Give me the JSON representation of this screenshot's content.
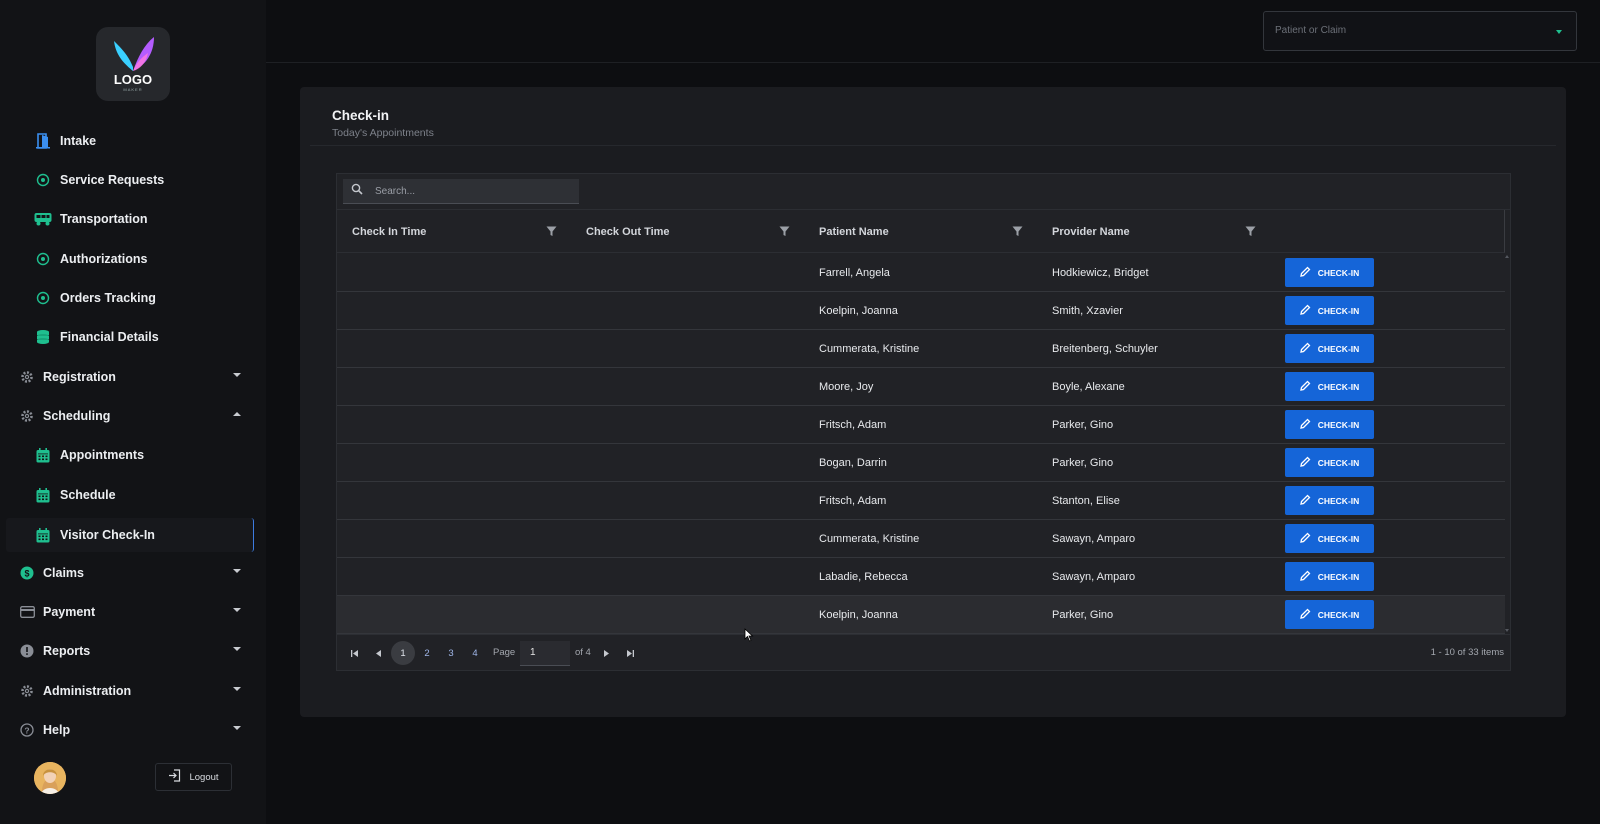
{
  "sidebar": {
    "logo_text": "LOGO",
    "logo_sub": "MAKER",
    "items": [
      {
        "label": "Intake",
        "icon": "door-icon",
        "type": "sub"
      },
      {
        "label": "Service Requests",
        "icon": "circle-dot-icon",
        "type": "sub"
      },
      {
        "label": "Transportation",
        "icon": "bus-icon",
        "type": "sub"
      },
      {
        "label": "Authorizations",
        "icon": "circle-dot-icon",
        "type": "sub"
      },
      {
        "label": "Orders Tracking",
        "icon": "circle-dot-icon",
        "type": "sub"
      },
      {
        "label": "Financial Details",
        "icon": "coins-icon",
        "type": "sub"
      },
      {
        "label": "Registration",
        "icon": "gear-icon",
        "type": "group",
        "expanded": false
      },
      {
        "label": "Scheduling",
        "icon": "gear-icon",
        "type": "group",
        "expanded": true
      },
      {
        "label": "Appointments",
        "icon": "calendar-icon",
        "type": "sub"
      },
      {
        "label": "Schedule",
        "icon": "calendar-icon",
        "type": "sub"
      },
      {
        "label": "Visitor Check-In",
        "icon": "calendar-icon",
        "type": "sub",
        "active": true
      },
      {
        "label": "Claims",
        "icon": "dollar-circle-icon",
        "type": "group",
        "expanded": false
      },
      {
        "label": "Payment",
        "icon": "credit-card-icon",
        "type": "group",
        "expanded": false
      },
      {
        "label": "Reports",
        "icon": "alert-circle-icon",
        "type": "group",
        "expanded": false
      },
      {
        "label": "Administration",
        "icon": "gear-icon",
        "type": "group",
        "expanded": false
      },
      {
        "label": "Help",
        "icon": "help-circle-icon",
        "type": "group",
        "expanded": false
      }
    ],
    "logout_label": "Logout"
  },
  "header": {
    "select_placeholder": "Patient or Claim"
  },
  "card": {
    "title": "Check-in",
    "subtitle": "Today's Appointments"
  },
  "grid": {
    "search_placeholder": "Search...",
    "columns": [
      "Check In Time",
      "Check Out Time",
      "Patient Name",
      "Provider Name"
    ],
    "action_label": "CHECK-IN",
    "rows": [
      {
        "check_in": "",
        "check_out": "",
        "patient": "Farrell, Angela",
        "provider": "Hodkiewicz, Bridget"
      },
      {
        "check_in": "",
        "check_out": "",
        "patient": "Koelpin, Joanna",
        "provider": "Smith, Xzavier"
      },
      {
        "check_in": "",
        "check_out": "",
        "patient": "Cummerata, Kristine",
        "provider": "Breitenberg, Schuyler"
      },
      {
        "check_in": "",
        "check_out": "",
        "patient": "Moore, Joy",
        "provider": "Boyle, Alexane"
      },
      {
        "check_in": "",
        "check_out": "",
        "patient": "Fritsch, Adam",
        "provider": "Parker, Gino"
      },
      {
        "check_in": "",
        "check_out": "",
        "patient": "Bogan, Darrin",
        "provider": "Parker, Gino"
      },
      {
        "check_in": "",
        "check_out": "",
        "patient": "Fritsch, Adam",
        "provider": "Stanton, Elise"
      },
      {
        "check_in": "",
        "check_out": "",
        "patient": "Cummerata, Kristine",
        "provider": "Sawayn, Amparo"
      },
      {
        "check_in": "",
        "check_out": "",
        "patient": "Labadie, Rebecca",
        "provider": "Sawayn, Amparo"
      },
      {
        "check_in": "",
        "check_out": "",
        "patient": "Koelpin, Joanna",
        "provider": "Parker, Gino"
      }
    ],
    "pager": {
      "pages": [
        "1",
        "2",
        "3",
        "4"
      ],
      "current": "1",
      "page_label": "Page",
      "page_value": "1",
      "of_label": "of 4",
      "items_info": "1 - 10 of 33 items"
    }
  },
  "colors": {
    "accent": "#1565d8",
    "icon_green": "#1fbf8f",
    "icon_blue": "#3b8ff0",
    "active_border": "#3d7be0"
  }
}
